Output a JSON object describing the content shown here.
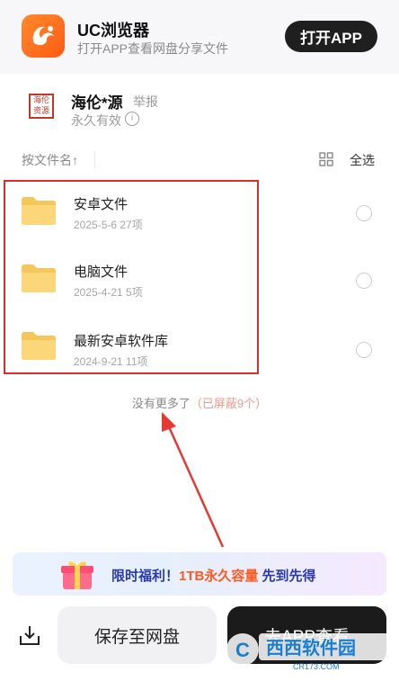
{
  "banner": {
    "app_name": "UC浏览器",
    "subtitle": "打开APP查看网盘分享文件",
    "open_button": "打开APP"
  },
  "sharer": {
    "avatar_text": "海伦资源",
    "name": "海伦*源",
    "report_label": "举报",
    "validity": "永久有效"
  },
  "toolbar": {
    "sort_label": "按文件名↑",
    "select_all": "全选"
  },
  "files": [
    {
      "name": "安卓文件",
      "meta": "2025-5-6  27项"
    },
    {
      "name": "电脑文件",
      "meta": "2025-4-21  5项"
    },
    {
      "name": "最新安卓软件库",
      "meta": "2024-9-21  11项"
    }
  ],
  "list_footer": {
    "no_more": "没有更多了",
    "hidden": "（已屏蔽9个）"
  },
  "promo": {
    "prefix": "限时福利！",
    "highlight": "1TB永久容量",
    "suffix": " 先到先得"
  },
  "bottom": {
    "save_button": "保存至网盘",
    "go_app_button": "去APP查看"
  },
  "watermark": {
    "brand": "西西软件园",
    "domain": "CR173.COM"
  },
  "colors": {
    "accent_orange": "#ff6a1a",
    "highlight_red": "#e12b2b",
    "dark_button": "#1b1b1b"
  }
}
